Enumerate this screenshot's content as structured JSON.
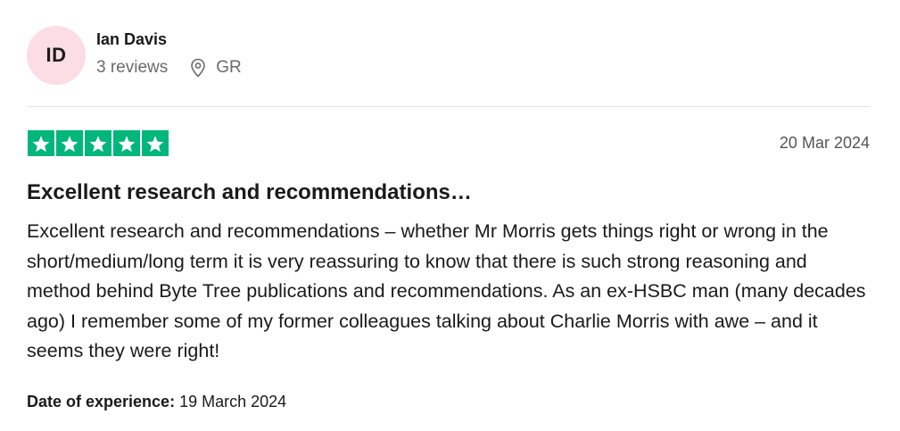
{
  "reviewer": {
    "initials": "ID",
    "name": "Ian Davis",
    "review_count": "3 reviews",
    "location": "GR",
    "location_icon": "location-pin-icon",
    "avatar_color": "#fbdde3"
  },
  "review": {
    "rating": 5,
    "star_color": "#00b67a",
    "date": "20 Mar 2024",
    "title": "Excellent research and recommendations…",
    "body": "Excellent research and recommendations – whether Mr Morris gets things right or wrong in the short/medium/long term it is very reassuring to know that there is such strong reasoning and method behind Byte Tree publications and recommendations. As an ex-HSBC man (many decades ago) I remember some of my former colleagues talking about Charlie Morris with awe – and it seems they were right!",
    "experience_label": "Date of experience:",
    "experience_date": "19 March 2024"
  }
}
